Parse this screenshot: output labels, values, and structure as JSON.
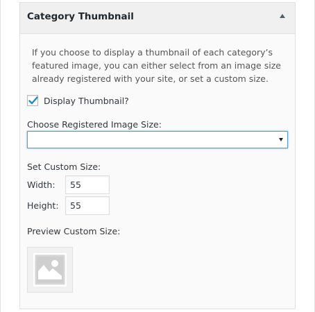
{
  "widget": {
    "title": "Category Thumbnail",
    "toggle_icon": "arrow-up-icon",
    "description": "If you choose to display a thumbnail of each category’s featured image, you can either select from an image size already registered with your site, or set a custom size.",
    "display_thumbnail": {
      "label": "Display Thumbnail?",
      "checked": true
    },
    "registered_size": {
      "label": "Choose Registered Image Size:",
      "selected": ""
    },
    "custom_size": {
      "label": "Set Custom Size:",
      "width_label": "Width:",
      "width_value": "55",
      "height_label": "Height:",
      "height_value": "55"
    },
    "preview": {
      "label": "Preview Custom Size:",
      "icon": "image-placeholder-icon"
    }
  },
  "colors": {
    "header_bg": "#f0f0f0",
    "focus_border": "#5b9dd9",
    "checkmark": "#1e8cbe"
  }
}
